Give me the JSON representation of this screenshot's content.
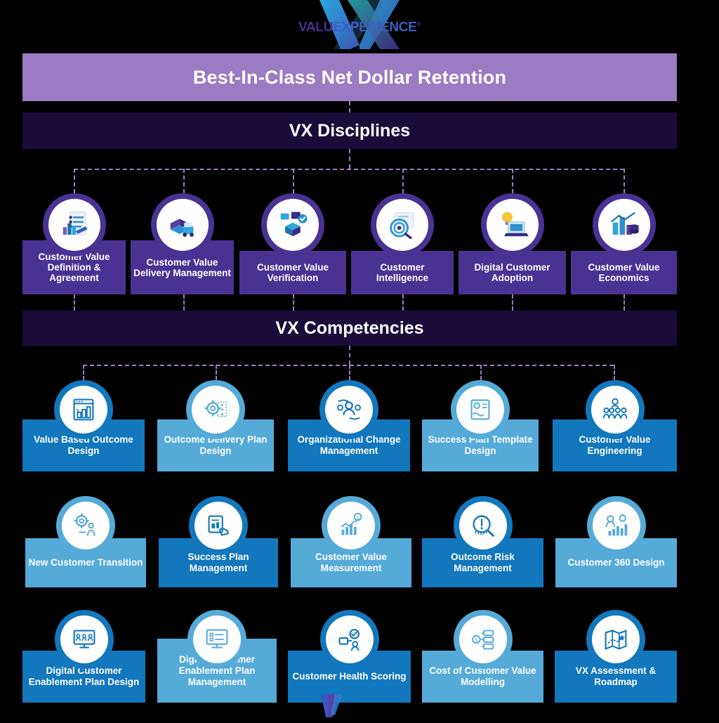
{
  "logo": {
    "word_part1": "VALU",
    "word_part2": "EXPERIENCE",
    "registered": "®",
    "mark": "VX"
  },
  "banners": {
    "retention": "Best-In-Class Net Dollar Retention",
    "disciplines": "VX Disciplines",
    "competencies": "VX Competencies"
  },
  "colors": {
    "banner_retention_bg": "#9a7bc4",
    "banner_dark_bg": "#1b0b3b",
    "discipline_purple": "#4a3293",
    "competency_blue_dark": "#1277bc",
    "competency_blue_light": "#55aad8",
    "connector": "#9a7bc4",
    "page_bg": "#000000"
  },
  "disciplines": [
    {
      "label": "Customer Value Definition & Agreement",
      "icon": "checklist-bar-chart-icon"
    },
    {
      "label": "Customer Value Delivery Management",
      "icon": "delivery-boxes-icon"
    },
    {
      "label": "Customer Value Verification",
      "icon": "verified-package-icon"
    },
    {
      "label": "Customer Intelligence",
      "icon": "target-magnifier-icon"
    },
    {
      "label": "Digital Customer Adoption",
      "icon": "laptop-idea-icon"
    },
    {
      "label": "Customer Value Economics",
      "icon": "bar-chart-coins-icon"
    }
  ],
  "competency_rows": [
    [
      {
        "label": "Value Based Outcome Design",
        "icon": "dashboard-chart-icon",
        "tone": "dark"
      },
      {
        "label": "Outcome Delivery Plan Design",
        "icon": "gear-network-icon",
        "tone": "light"
      },
      {
        "label": "Organizational Change Management",
        "icon": "people-change-icon",
        "tone": "dark"
      },
      {
        "label": "Success Plan Template Design",
        "icon": "document-plan-icon",
        "tone": "light"
      },
      {
        "label": "Customer Value Engineering",
        "icon": "team-group-icon",
        "tone": "dark"
      }
    ],
    [
      {
        "label": "New Customer Transition",
        "icon": "gear-person-transition-icon",
        "tone": "light"
      },
      {
        "label": "Success Plan Management",
        "icon": "hand-document-icon",
        "tone": "dark"
      },
      {
        "label": "Customer Value Measurement",
        "icon": "growth-chart-icon",
        "tone": "light"
      },
      {
        "label": "Outcome Risk Management",
        "icon": "risk-magnifier-icon",
        "tone": "dark"
      },
      {
        "label": "Customer 360 Design",
        "icon": "person-chart-360-icon",
        "tone": "light"
      }
    ],
    [
      {
        "label": "Digital Customer Enablement Plan Design",
        "icon": "monitor-people-icon",
        "tone": "dark"
      },
      {
        "label": "Digital Customer Enablement Plan Management",
        "icon": "monitor-checklist-icon",
        "tone": "light"
      },
      {
        "label": "Customer Health Scoring",
        "icon": "health-score-person-icon",
        "tone": "dark"
      },
      {
        "label": "Cost of Customer Value Modelling",
        "icon": "cost-stack-icon",
        "tone": "light"
      },
      {
        "label": "VX Assessment & Roadmap",
        "icon": "map-roadmap-icon",
        "tone": "dark"
      }
    ]
  ]
}
